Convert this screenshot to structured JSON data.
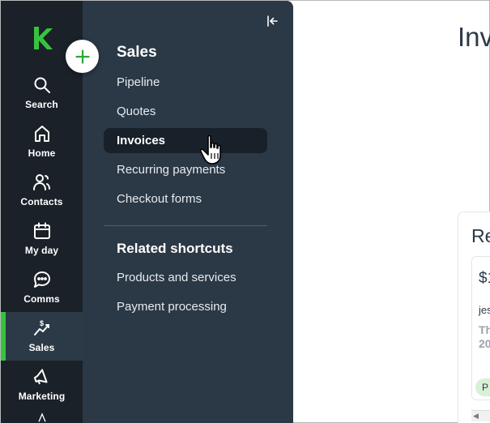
{
  "rail": {
    "items": [
      {
        "label": "Search",
        "icon": "search-icon"
      },
      {
        "label": "Home",
        "icon": "home-icon"
      },
      {
        "label": "Contacts",
        "icon": "contacts-icon"
      },
      {
        "label": "My day",
        "icon": "calendar-icon"
      },
      {
        "label": "Comms",
        "icon": "chat-bubble-icon"
      },
      {
        "label": "Sales",
        "icon": "sales-chart-icon",
        "active": true
      },
      {
        "label": "Marketing",
        "icon": "megaphone-icon"
      }
    ],
    "accent_color": "#37c33f"
  },
  "panel": {
    "title": "Sales",
    "items": [
      {
        "label": "Pipeline"
      },
      {
        "label": "Quotes"
      },
      {
        "label": "Invoices",
        "selected": true
      },
      {
        "label": "Recurring payments"
      },
      {
        "label": "Checkout forms"
      }
    ],
    "related_title": "Related shortcuts",
    "related_items": [
      {
        "label": "Products and services"
      },
      {
        "label": "Payment processing"
      }
    ]
  },
  "main": {
    "title": "Inv",
    "card": {
      "title": "Re",
      "amount": "$1",
      "customer": "jes",
      "date_line1": "Th",
      "date_line2": "20",
      "status": "P"
    }
  },
  "colors": {
    "rail_bg": "#1a2128",
    "panel_bg": "#2b3846",
    "selected_bg": "#18202a",
    "brand_green": "#37c33f"
  }
}
